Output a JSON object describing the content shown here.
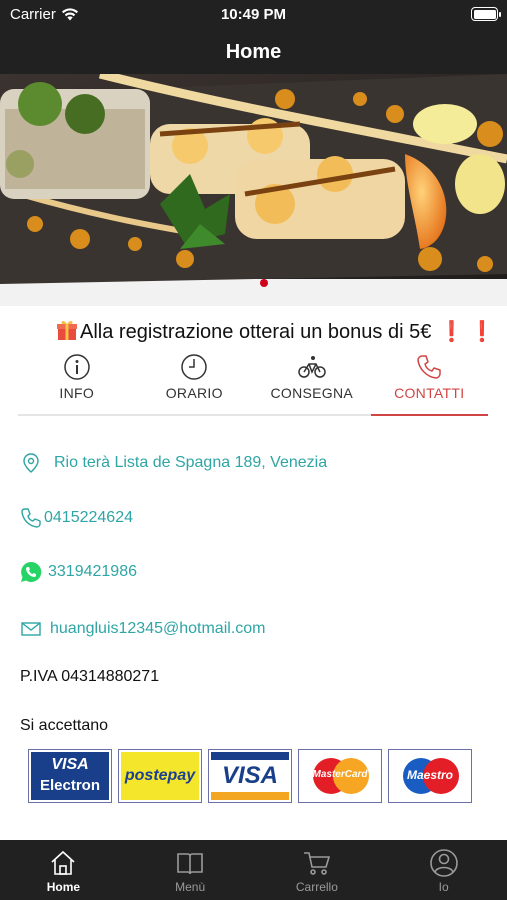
{
  "status_bar": {
    "carrier": "Carrier",
    "time": "10:49 PM"
  },
  "nav": {
    "title": "Home"
  },
  "promo": {
    "text": "Alla registrazione otterai un bonus di 5€",
    "marks": "❗ ❗"
  },
  "tabs": [
    {
      "label": "INFO",
      "icon": "info-icon"
    },
    {
      "label": "ORARIO",
      "icon": "clock-icon"
    },
    {
      "label": "CONSEGNA",
      "icon": "bicycle-icon"
    },
    {
      "label": "CONTATTI",
      "icon": "phone-icon",
      "active": true
    }
  ],
  "contacts": {
    "address": "Rio terà Lista de Spagna 189,    Venezia",
    "phone": "0415224624",
    "whatsapp": "3319421986",
    "email": "huangluis12345@hotmail.com"
  },
  "piva": "P.IVA 04314880271",
  "accept_label": "Si accettano",
  "cards": {
    "visa_electron": {
      "line1": "VISA",
      "line2": "Electron"
    },
    "postepay": "postepay",
    "visa": "VISA",
    "mastercard": "MasterCard",
    "maestro": "Maestro"
  },
  "tabbar": [
    {
      "label": "Home",
      "icon": "home-icon",
      "active": true
    },
    {
      "label": "Menù",
      "icon": "book-icon"
    },
    {
      "label": "Carrello",
      "icon": "cart-icon"
    },
    {
      "label": "Io",
      "icon": "user-icon"
    }
  ],
  "colors": {
    "accent": "#d14444",
    "link": "#2fa5a5",
    "bar": "#212121",
    "whatsapp": "#25d366"
  }
}
